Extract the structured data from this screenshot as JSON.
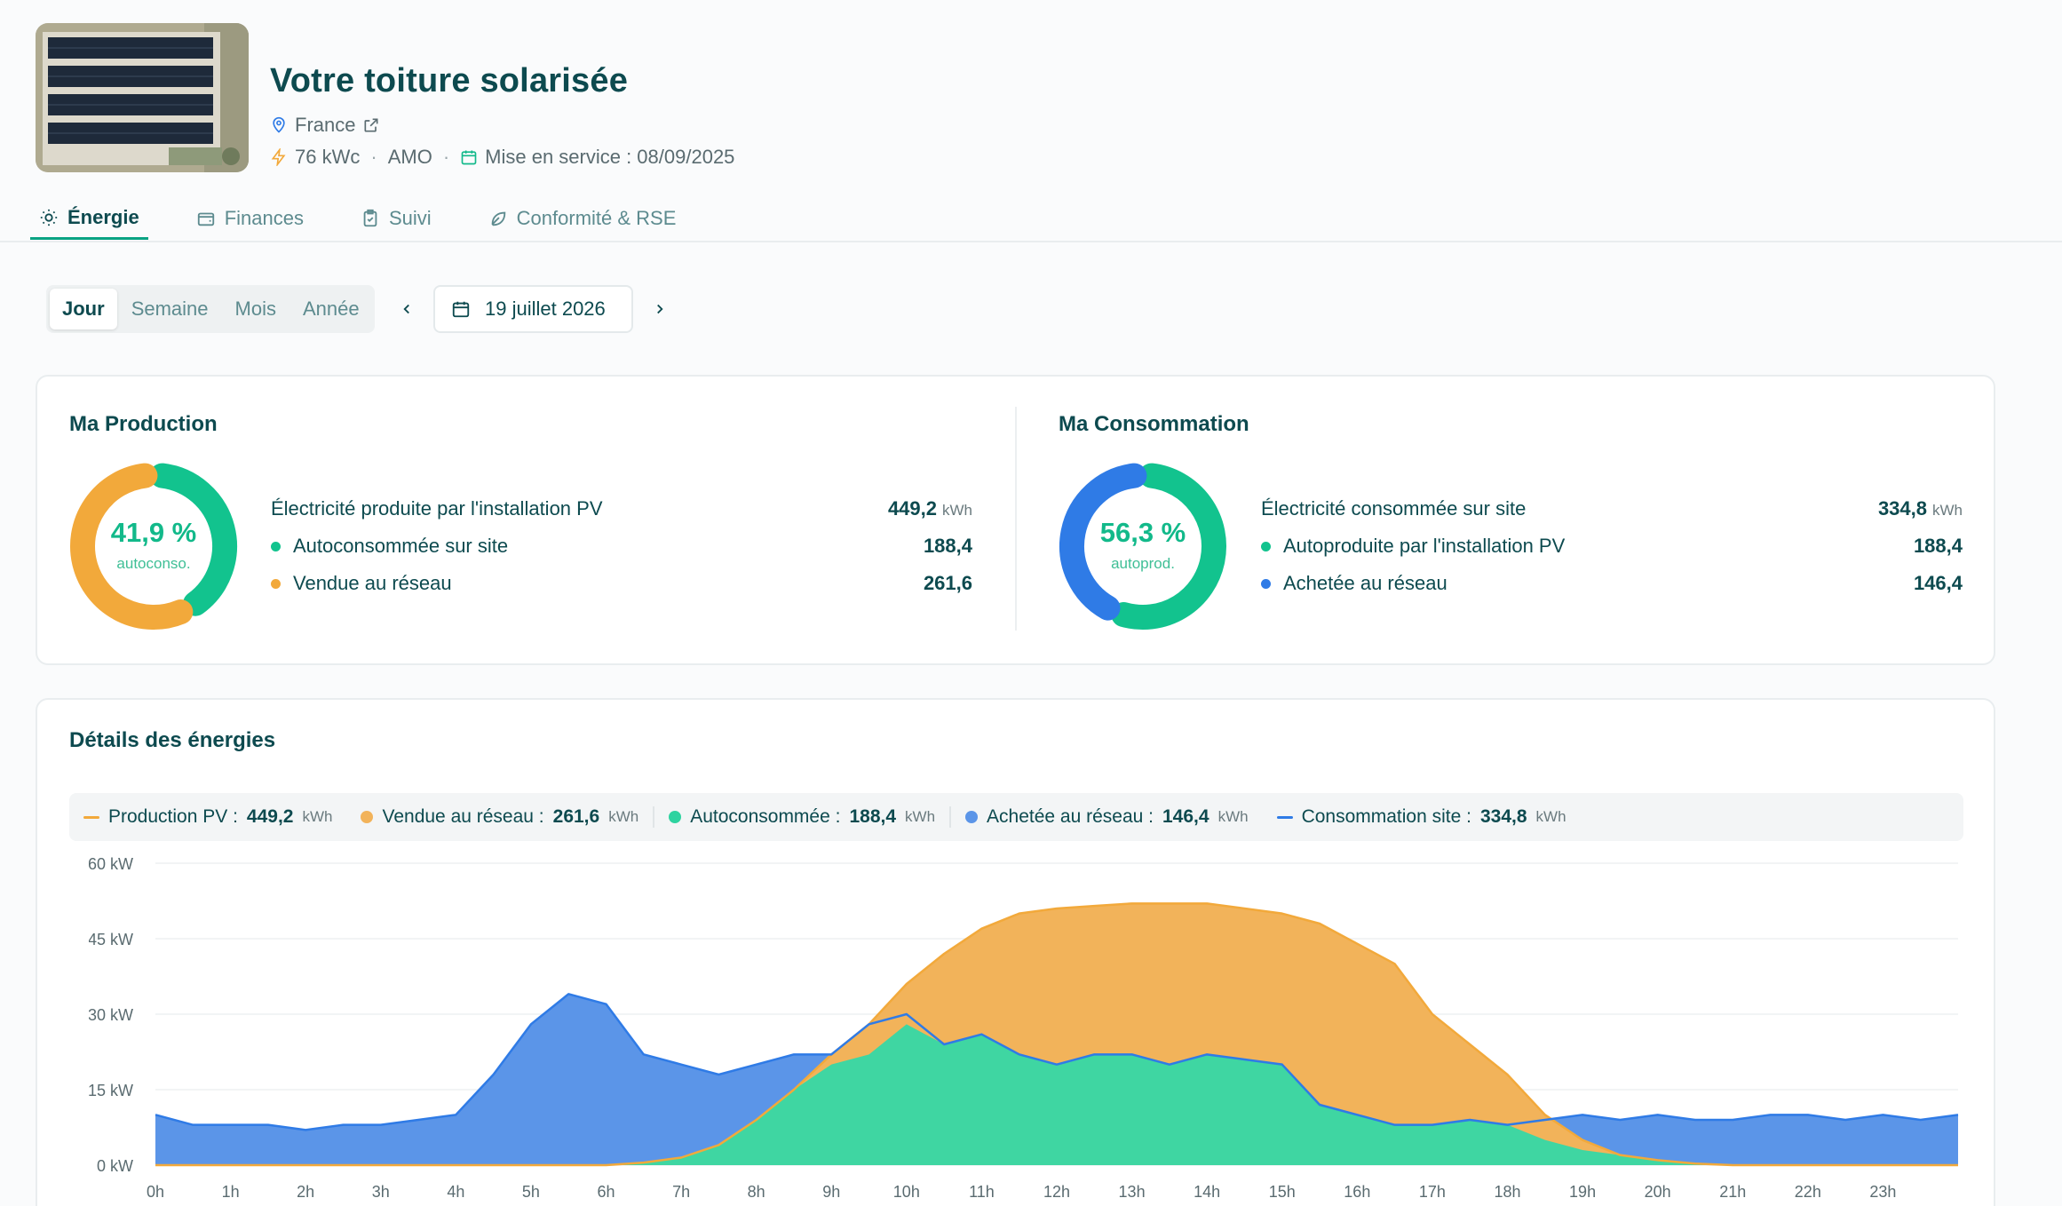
{
  "header": {
    "title": "Votre toiture solarisée",
    "location": "France",
    "power": "76 kWc",
    "mode": "AMO",
    "commissioning": "Mise en service : 08/09/2025"
  },
  "tabs": [
    {
      "label": "Énergie",
      "icon": "sun-icon",
      "active": true
    },
    {
      "label": "Finances",
      "icon": "wallet-icon",
      "active": false
    },
    {
      "label": "Suivi",
      "icon": "clipboard-check-icon",
      "active": false
    },
    {
      "label": "Conformité & RSE",
      "icon": "leaf-icon",
      "active": false
    }
  ],
  "period": {
    "options": [
      "Jour",
      "Semaine",
      "Mois",
      "Année"
    ],
    "selected": "Jour",
    "date": "19 juillet 2026"
  },
  "production": {
    "title": "Ma Production",
    "percent": "41,9 %",
    "percent_value": 41.9,
    "caption": "autoconso.",
    "total_label": "Électricité produite par l'installation PV",
    "total_value": "449,2",
    "unit": "kWh",
    "rows": [
      {
        "label": "Autoconsommée sur site",
        "value": "188,4",
        "color": "#12c38e"
      },
      {
        "label": "Vendue au réseau",
        "value": "261,6",
        "color": "#f2a93b"
      }
    ]
  },
  "consumption": {
    "title": "Ma Consommation",
    "percent": "56,3 %",
    "percent_value": 56.3,
    "caption": "autoprod.",
    "total_label": "Électricité consommée sur site",
    "total_value": "334,8",
    "unit": "kWh",
    "rows": [
      {
        "label": "Autoproduite par l'installation PV",
        "value": "188,4",
        "color": "#12c38e"
      },
      {
        "label": "Achetée au réseau",
        "value": "146,4",
        "color": "#2f7be6"
      }
    ]
  },
  "details": {
    "title": "Détails des énergies",
    "unit": "kWh",
    "legend": [
      {
        "label": "Production PV : ",
        "value": "449,2",
        "color": "#f2a93b",
        "marker": "line"
      },
      {
        "label": "Vendue au réseau : ",
        "value": "261,6",
        "color": "#f2b35a",
        "marker": "dot"
      },
      {
        "label": "Autoconsommée : ",
        "value": "188,4",
        "color": "#2ed3a0",
        "marker": "dot"
      },
      {
        "label": "Achetée au réseau : ",
        "value": "146,4",
        "color": "#5b95e8",
        "marker": "dot"
      },
      {
        "label": "Consommation site : ",
        "value": "334,8",
        "color": "#2f7be6",
        "marker": "line"
      }
    ]
  },
  "chart_data": {
    "type": "area",
    "x_unit": "h",
    "y_ticks": [
      "60 kW",
      "45 kW",
      "30 kW",
      "15 kW",
      "0 kW"
    ],
    "ylim": [
      0,
      60
    ],
    "x_ticks": [
      "0h",
      "1h",
      "2h",
      "3h",
      "4h",
      "5h",
      "6h",
      "7h",
      "8h",
      "9h",
      "10h",
      "11h",
      "12h",
      "13h",
      "14h",
      "15h",
      "16h",
      "17h",
      "18h",
      "19h",
      "20h",
      "21h",
      "22h",
      "23h"
    ],
    "hours": [
      0,
      0.5,
      1,
      1.5,
      2,
      2.5,
      3,
      3.5,
      4,
      4.5,
      5,
      5.5,
      6,
      6.5,
      7,
      7.5,
      8,
      8.5,
      9,
      9.5,
      10,
      10.5,
      11,
      11.5,
      12,
      12.5,
      13,
      13.5,
      14,
      14.5,
      15,
      15.5,
      16,
      16.5,
      17,
      17.5,
      18,
      18.5,
      19,
      19.5,
      20,
      20.5,
      21,
      21.5,
      22,
      22.5,
      23,
      23.5,
      24
    ],
    "series": [
      {
        "name": "Production PV",
        "color": "#f2a93b",
        "values": [
          0,
          0,
          0,
          0,
          0,
          0,
          0,
          0,
          0,
          0,
          0,
          0,
          0,
          0.5,
          1.5,
          4,
          9,
          15,
          22,
          28,
          36,
          42,
          47,
          50,
          51,
          51.5,
          52,
          52,
          52,
          51,
          50,
          48,
          44,
          40,
          30,
          24,
          18,
          10,
          5,
          2,
          1,
          0.3,
          0,
          0,
          0,
          0,
          0,
          0,
          0
        ]
      },
      {
        "name": "Consommation site",
        "color": "#2f7be6",
        "values": [
          10,
          8,
          8,
          8,
          7,
          8,
          8,
          9,
          10,
          18,
          28,
          34,
          32,
          22,
          20,
          18,
          20,
          22,
          22,
          28,
          30,
          24,
          26,
          22,
          20,
          22,
          22,
          20,
          22,
          21,
          20,
          12,
          10,
          8,
          8,
          9,
          8,
          9,
          10,
          9,
          10,
          9,
          9,
          10,
          10,
          9,
          10,
          9,
          10
        ]
      },
      {
        "name": "Autoconsommée",
        "color": "#3fd6a2",
        "values": [
          0,
          0,
          0,
          0,
          0,
          0,
          0,
          0,
          0,
          0,
          0,
          0,
          0,
          0.5,
          1.5,
          4,
          9,
          15,
          20,
          22,
          28,
          24,
          26,
          22,
          20,
          22,
          22,
          20,
          22,
          21,
          20,
          12,
          10,
          8,
          8,
          9,
          8,
          5,
          3,
          2,
          1,
          0.3,
          0,
          0,
          0,
          0,
          0,
          0,
          0
        ]
      }
    ]
  }
}
